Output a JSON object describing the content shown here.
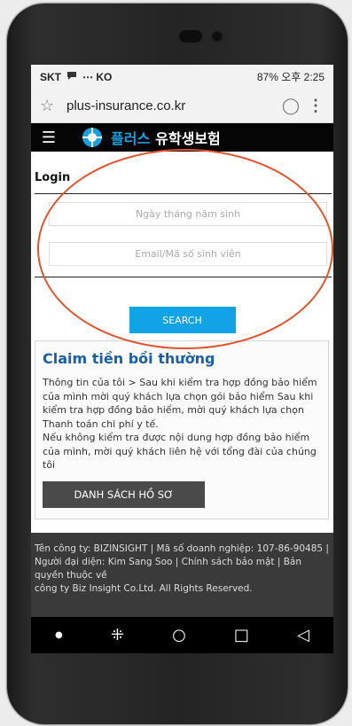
{
  "status": {
    "carrier": "SKT",
    "right_text": "87% 오후 2:25",
    "left_icons": "⋯ KO"
  },
  "browser": {
    "url": "plus-insurance.co.kr"
  },
  "header": {
    "brand_part1": "플러스",
    "brand_part2": "유학생보험"
  },
  "login": {
    "title": "Login",
    "dob_placeholder": "Ngày tháng năm sinh",
    "email_placeholder": "Email/Mã số sinh viên",
    "search_label": "SEARCH"
  },
  "claim": {
    "title": "Claim tiền bồi thường",
    "body": "Thông tin của tôi > Sau khi kiểm tra hợp đồng bảo hiểm của mình mời quý khách lựa chọn gói bảo hiểm Sau khi kiểm tra hợp đồng bảo hiểm, mời quý khách lựa chọn Thanh toán chi phí y tế.",
    "body2": "Nếu không kiểm tra được nội dung hợp đồng bảo hiểm của mình, mời quý khách liên hệ với tổng đài của chúng tôi",
    "button_label": "DANH SÁCH HỒ SƠ"
  },
  "footer": {
    "line1": "Tên công ty: BIZINSIGHT | Mã số doanh nghiệp: 107-86-90485 | Người đại diện: Kim Sang Soo | Chính sách bảo mật | Bản quyền thuộc về",
    "line2": "công ty Biz Insight Co.Ltd. All Rights Reserved."
  },
  "colors": {
    "accent": "#10a3e5",
    "claim_title": "#1b5fa8",
    "annotation": "#e2532d"
  },
  "icons": [
    "message-icon",
    "bluetooth-icon",
    "star-icon",
    "reload-icon",
    "more-icon",
    "menu-icon",
    "logo-icon",
    "recent-apps-icon",
    "home-icon",
    "back-icon"
  ]
}
